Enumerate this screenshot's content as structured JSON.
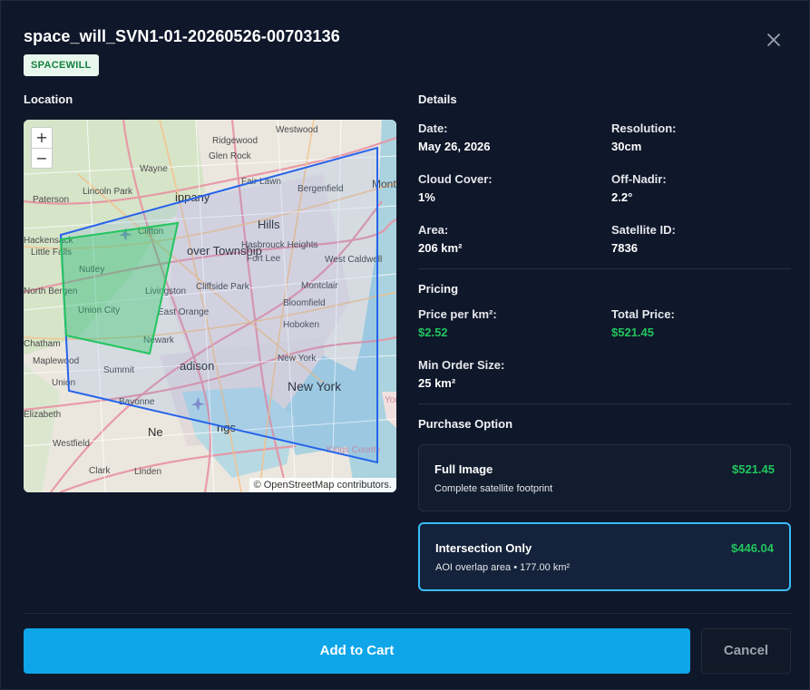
{
  "header": {
    "title": "space_will_SVN1-01-20260526-00703136",
    "badge": "SPACEWILL"
  },
  "location": {
    "label": "Location",
    "zoom_in": "+",
    "zoom_out": "−",
    "attribution": "© OpenStreetMap contributors.",
    "place_labels": [
      "Westwood",
      "Ridgewood",
      "Glen Rock",
      "Wayne",
      "Fair Lawn",
      "Bergenfield",
      "Lincoln Park",
      "Paterson",
      "Montville",
      "Hackensack",
      "Little Falls",
      "Clifton",
      "Hasbrouck Heights",
      "Fort Lee",
      "West Caldwell",
      "Nutley",
      "Cliffside Park",
      "Montclair",
      "North Bergen",
      "Livingston",
      "Bloomfield",
      "Union City",
      "East Orange",
      "Hoboken",
      "Chatham",
      "Newark",
      "Maplewood",
      "New York",
      "Summit",
      "Union",
      "Bayonne",
      "Elizabeth",
      "Westfield",
      "Clark",
      "Linden",
      "Kings County",
      "Yonk",
      "ippany",
      "Hills",
      "over Township",
      "adison",
      "ngs",
      "Ne"
    ]
  },
  "details": {
    "label": "Details",
    "date": {
      "label": "Date:",
      "value": "May 26, 2026"
    },
    "resolution": {
      "label": "Resolution:",
      "value": "30cm"
    },
    "cloud_cover": {
      "label": "Cloud Cover:",
      "value": "1%"
    },
    "off_nadir": {
      "label": "Off-Nadir:",
      "value": "2.2°"
    },
    "area": {
      "label": "Area:",
      "value": "206 km²"
    },
    "satellite_id": {
      "label": "Satellite ID:",
      "value": "7836"
    }
  },
  "pricing": {
    "label": "Pricing",
    "price_per_km": {
      "label": "Price per km²:",
      "value": "$2.52"
    },
    "total_price": {
      "label": "Total Price:",
      "value": "$521.45"
    },
    "min_order": {
      "label": "Min Order Size:",
      "value": "25 km²"
    }
  },
  "purchase": {
    "label": "Purchase Option",
    "options": [
      {
        "name": "Full Image",
        "price": "$521.45",
        "description": "Complete satellite footprint",
        "selected": false
      },
      {
        "name": "Intersection Only",
        "price": "$446.04",
        "description": "AOI overlap area • 177.00 km²",
        "selected": true
      }
    ]
  },
  "footer": {
    "add_to_cart": "Add to Cart",
    "cancel": "Cancel"
  },
  "colors": {
    "background": "#0f172a",
    "accent": "#0ea5e9",
    "price_green": "#22c55e",
    "footprint_blue": "#2563eb",
    "aoi_green": "#22c55e"
  }
}
